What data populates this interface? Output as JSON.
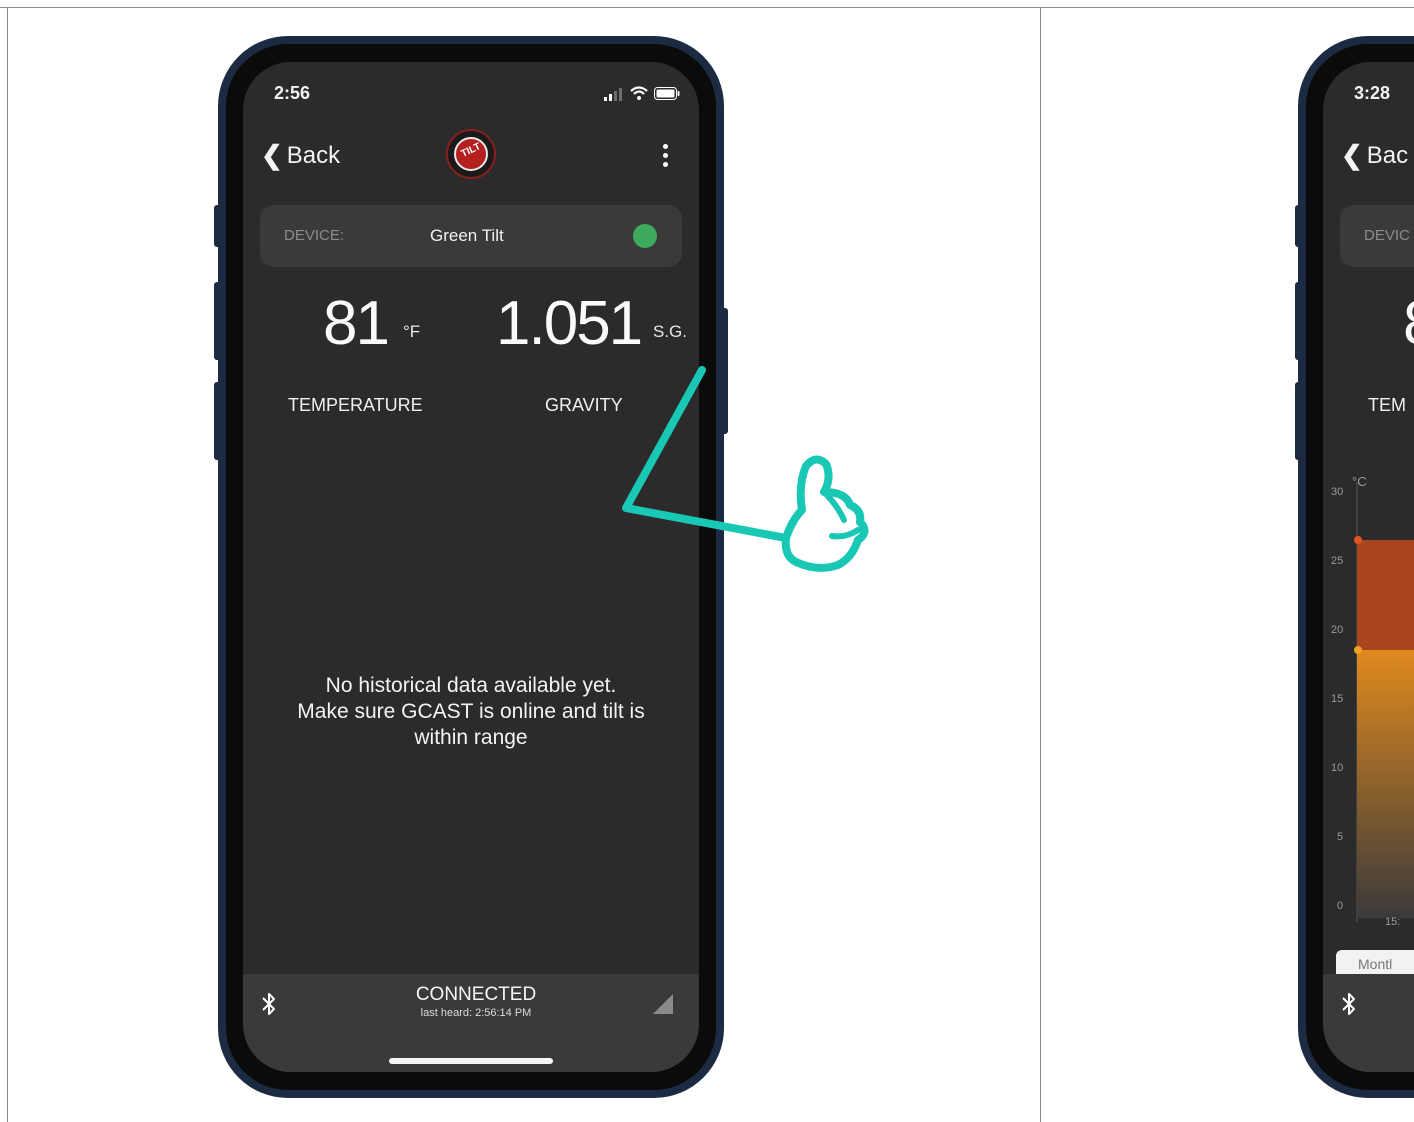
{
  "left_phone": {
    "status_time": "2:56",
    "back_label": "Back",
    "logo_text": "TILT",
    "device_label": "DEVICE:",
    "device_name": "Green Tilt",
    "temperature_value": "81",
    "temperature_unit": "°F",
    "temperature_caption": "TEMPERATURE",
    "gravity_value": "1.051",
    "gravity_unit": "S.G.",
    "gravity_caption": "GRAVITY",
    "message_line1": "No historical data available yet.",
    "message_line2": "Make sure GCAST is online and tilt is",
    "message_line3": "within range",
    "connection_status": "CONNECTED",
    "last_heard": "last heard: 2:56:14 PM",
    "device_status_color": "#3dab5b"
  },
  "right_phone": {
    "status_time": "3:28",
    "back_label": "Bac",
    "device_label": "DEVIC",
    "temperature_value_partial": "8",
    "temperature_caption_partial": "TEM",
    "chart_unit": "°C",
    "y_ticks": [
      "30",
      "25",
      "20",
      "15",
      "10",
      "5",
      "0"
    ],
    "x_tick_partial": "15:",
    "range_button_partial": "Montl"
  },
  "colors": {
    "phone_frame": "#1d2b42",
    "screen_bg": "#2b2b2c",
    "annotation": "#19c7b5",
    "chart_upper": "#a8451d",
    "chart_lower": "#e08a1e"
  },
  "icons": {
    "signal": "signal-bars-icon",
    "wifi": "wifi-icon",
    "battery": "battery-icon",
    "bluetooth": "bluetooth-icon",
    "menu": "kebab-menu-icon",
    "annotation": "thumbs-up-pointer-drawing"
  }
}
